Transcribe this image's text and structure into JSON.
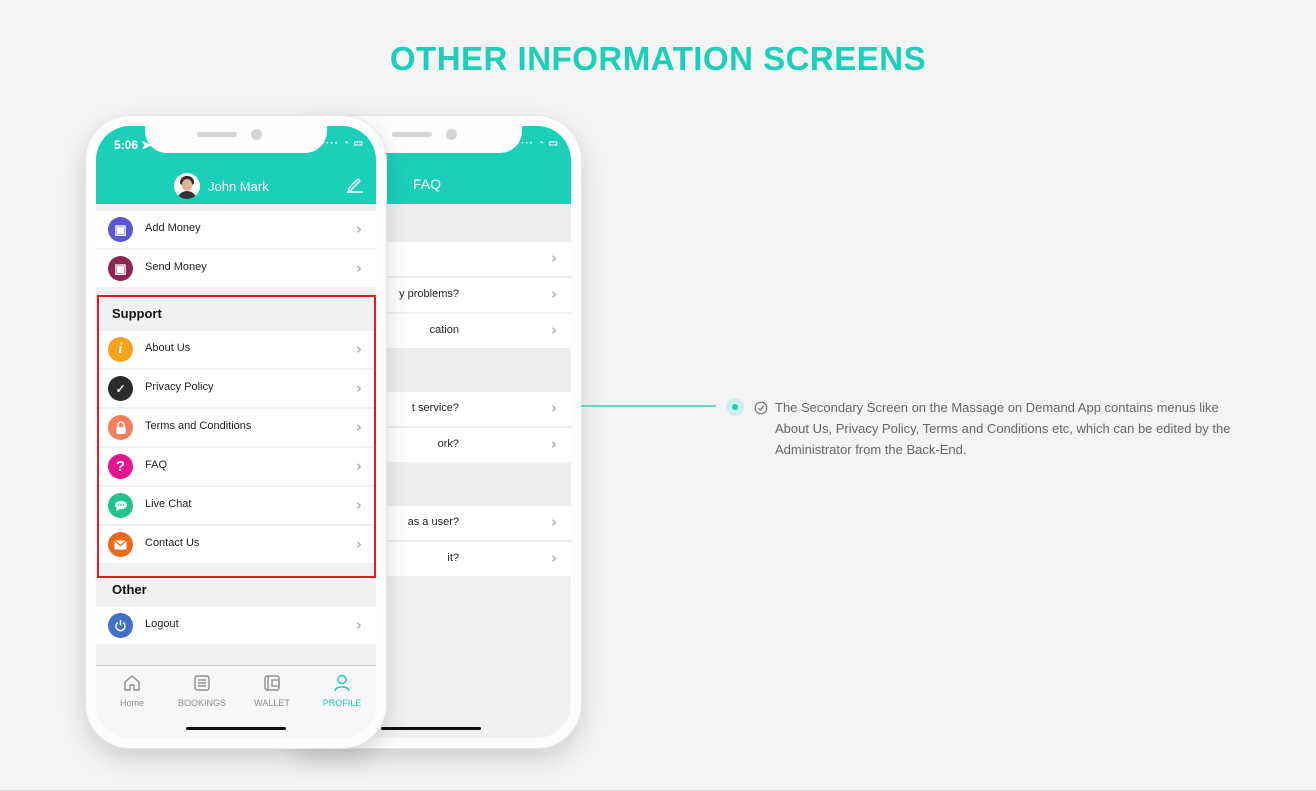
{
  "page": {
    "title": "OTHER INFORMATION SCREENS"
  },
  "colors": {
    "accent": "#1ccfb9",
    "highlight_border": "#e11b22",
    "background": "#f4f4f4"
  },
  "back_phone": {
    "status_time": "",
    "header_title": "FAQ",
    "rows": [
      {
        "text": ""
      },
      {
        "text": "y problems?"
      },
      {
        "text": "cation"
      },
      {
        "text": "t service?"
      },
      {
        "text": "ork?"
      },
      {
        "text": "as a user?"
      },
      {
        "text": "it?"
      }
    ]
  },
  "front_phone": {
    "status_time": "5:06",
    "user_name": "John Mark",
    "wallet_items": [
      {
        "label": "Add Money",
        "icon": "wallet-add-icon",
        "color": "#5957cf"
      },
      {
        "label": "Send Money",
        "icon": "wallet-send-icon",
        "color": "#8b2657"
      }
    ],
    "support_heading": "Support",
    "support_items": [
      {
        "label": "About Us",
        "icon": "info-icon",
        "color": "#f5a31a"
      },
      {
        "label": "Privacy Policy",
        "icon": "privacy-lock-icon",
        "color": "#2b2b2b"
      },
      {
        "label": "Terms and Conditions",
        "icon": "lock-icon",
        "color": "#f47f5f"
      },
      {
        "label": "FAQ",
        "icon": "question-icon",
        "color": "#e3178c"
      },
      {
        "label": "Live Chat",
        "icon": "chat-icon",
        "color": "#22c38e"
      },
      {
        "label": "Contact Us",
        "icon": "mail-icon",
        "color": "#ec6a1c"
      }
    ],
    "other_heading": "Other",
    "other_items": [
      {
        "label": "Logout",
        "icon": "power-icon",
        "color": "#3f6fc9"
      }
    ],
    "tabs": [
      {
        "label": "Home",
        "icon": "home-icon",
        "active": false
      },
      {
        "label": "BOOKINGS",
        "icon": "bookings-icon",
        "active": false
      },
      {
        "label": "WALLET",
        "icon": "wallet-icon",
        "active": false
      },
      {
        "label": "PROFILE",
        "icon": "profile-icon",
        "active": true
      }
    ]
  },
  "callout": {
    "text": "The Secondary Screen on the Massage on Demand App contains menus like About Us, Privacy Policy, Terms and Conditions etc, which can be edited by the Administrator from the Back-End."
  }
}
